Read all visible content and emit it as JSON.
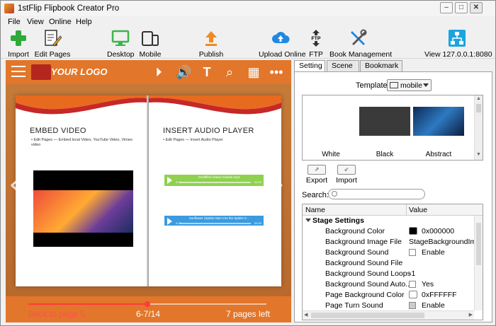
{
  "window": {
    "title": "1stFlip Flipbook Creator Pro",
    "min": "–",
    "max": "□",
    "close": "✕"
  },
  "menu": [
    "File",
    "View",
    "Online",
    "Help"
  ],
  "toolbar": {
    "import": "Import",
    "edit_pages": "Edit Pages",
    "desktop": "Desktop",
    "mobile": "Mobile",
    "publish": "Publish",
    "upload_online": "Upload Online",
    "ftp": "FTP",
    "ftp_badge": "FTP",
    "book_management": "Book Management",
    "view": "View 127.0.0.1:8080"
  },
  "colors": {
    "toolbar_import": "#2eaa3a",
    "desktop_green": "#3bb54a",
    "publish_orange": "#f08a24",
    "upload_blue": "#1f88e5",
    "view_cyan": "#1aa4e0",
    "preview_orange": "#e2762a"
  },
  "preview": {
    "logo": "YOUR LOGO",
    "icons": [
      "play-icon",
      "volume-icon",
      "text-icon",
      "search-icon",
      "grid-icon",
      "more-icon"
    ],
    "left_page": {
      "title": "EMBED VIDEO",
      "subtitle": "• Edit Pages — Embed local Video, YouTube Video, Vimeo video"
    },
    "right_page": {
      "title": "INSERT AUDIO PLAYER",
      "subtitle": "• Edit Pages — Insert Audio Player",
      "audio1": {
        "track": "Smallfish Ariana Grande.mp3",
        "t0": "0:00",
        "t1": "00:00"
      },
      "audio2": {
        "track": "Sunflower (Spider-Man Into the Spider-V...",
        "t0": "0:00",
        "t1": "00:00"
      }
    },
    "back_to_page": "Back to page 5",
    "page_num": "6-7/14",
    "pages_left": "7 pages left",
    "progress": 0.5
  },
  "panel": {
    "tabs": [
      "Setting",
      "Scene",
      "Bookmark"
    ],
    "template_label": "Template:",
    "template_value": "mobile",
    "templates": [
      "White",
      "Black",
      "Abstract"
    ],
    "export": "Export",
    "import": "Import",
    "search_label": "Search:",
    "search_value": "",
    "grid": {
      "col_name": "Name",
      "col_value": "Value",
      "section": "Stage Settings",
      "rows": [
        {
          "name": "Background Color",
          "value": "0x000000",
          "swatch": "#000000"
        },
        {
          "name": "Background Image File",
          "value": "StageBackgroundImage"
        },
        {
          "name": "Background Sound",
          "value": "Enable",
          "check": true
        },
        {
          "name": "Background Sound File",
          "value": ""
        },
        {
          "name": "Background Sound Loops",
          "value": "-1"
        },
        {
          "name": "Background Sound Auto...",
          "value": "Yes",
          "check": true
        },
        {
          "name": "Page Background Color",
          "value": "0xFFFFFF",
          "swatch": "#ffffff"
        },
        {
          "name": "Page Turn Sound",
          "value": "Enable",
          "check": true
        }
      ]
    }
  }
}
